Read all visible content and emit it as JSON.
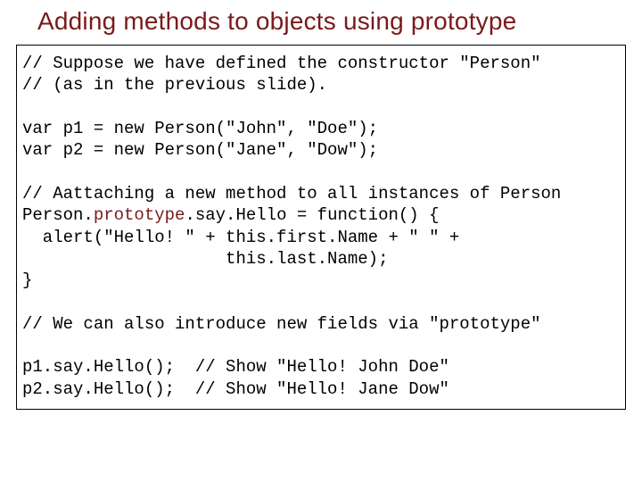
{
  "title": "Adding methods to objects using prototype",
  "code": {
    "l01": "// Suppose we have defined the constructor \"Person\"",
    "l02": "// (as in the previous slide).",
    "l03": "var p1 = new Person(\"John\", \"Doe\");",
    "l04": "var p2 = new Person(\"Jane\", \"Dow\");",
    "l05": "// Aattaching a new method to all instances of Person",
    "l06a": "Person.",
    "l06b": "prototype",
    "l06c": ".say.Hello = function() {",
    "l07": "  alert(\"Hello! \" + this.first.Name + \" \" +",
    "l08": "                    this.last.Name);",
    "l09": "}",
    "l10": "// We can also introduce new fields via \"prototype\"",
    "l11": "p1.say.Hello();  // Show \"Hello! John Doe\"",
    "l12": "p2.say.Hello();  // Show \"Hello! Jane Dow\""
  }
}
